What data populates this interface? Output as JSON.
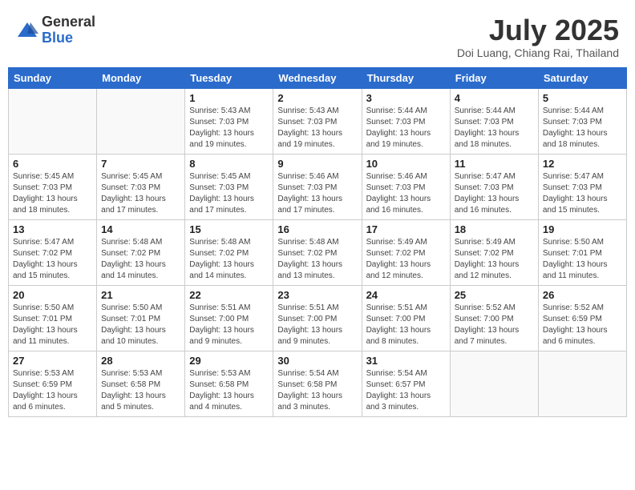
{
  "logo": {
    "general": "General",
    "blue": "Blue"
  },
  "header": {
    "month": "July 2025",
    "location": "Doi Luang, Chiang Rai, Thailand"
  },
  "weekdays": [
    "Sunday",
    "Monday",
    "Tuesday",
    "Wednesday",
    "Thursday",
    "Friday",
    "Saturday"
  ],
  "weeks": [
    [
      {
        "day": null,
        "detail": null
      },
      {
        "day": null,
        "detail": null
      },
      {
        "day": "1",
        "detail": "Sunrise: 5:43 AM\nSunset: 7:03 PM\nDaylight: 13 hours and 19 minutes."
      },
      {
        "day": "2",
        "detail": "Sunrise: 5:43 AM\nSunset: 7:03 PM\nDaylight: 13 hours and 19 minutes."
      },
      {
        "day": "3",
        "detail": "Sunrise: 5:44 AM\nSunset: 7:03 PM\nDaylight: 13 hours and 19 minutes."
      },
      {
        "day": "4",
        "detail": "Sunrise: 5:44 AM\nSunset: 7:03 PM\nDaylight: 13 hours and 18 minutes."
      },
      {
        "day": "5",
        "detail": "Sunrise: 5:44 AM\nSunset: 7:03 PM\nDaylight: 13 hours and 18 minutes."
      }
    ],
    [
      {
        "day": "6",
        "detail": "Sunrise: 5:45 AM\nSunset: 7:03 PM\nDaylight: 13 hours and 18 minutes."
      },
      {
        "day": "7",
        "detail": "Sunrise: 5:45 AM\nSunset: 7:03 PM\nDaylight: 13 hours and 17 minutes."
      },
      {
        "day": "8",
        "detail": "Sunrise: 5:45 AM\nSunset: 7:03 PM\nDaylight: 13 hours and 17 minutes."
      },
      {
        "day": "9",
        "detail": "Sunrise: 5:46 AM\nSunset: 7:03 PM\nDaylight: 13 hours and 17 minutes."
      },
      {
        "day": "10",
        "detail": "Sunrise: 5:46 AM\nSunset: 7:03 PM\nDaylight: 13 hours and 16 minutes."
      },
      {
        "day": "11",
        "detail": "Sunrise: 5:47 AM\nSunset: 7:03 PM\nDaylight: 13 hours and 16 minutes."
      },
      {
        "day": "12",
        "detail": "Sunrise: 5:47 AM\nSunset: 7:03 PM\nDaylight: 13 hours and 15 minutes."
      }
    ],
    [
      {
        "day": "13",
        "detail": "Sunrise: 5:47 AM\nSunset: 7:02 PM\nDaylight: 13 hours and 15 minutes."
      },
      {
        "day": "14",
        "detail": "Sunrise: 5:48 AM\nSunset: 7:02 PM\nDaylight: 13 hours and 14 minutes."
      },
      {
        "day": "15",
        "detail": "Sunrise: 5:48 AM\nSunset: 7:02 PM\nDaylight: 13 hours and 14 minutes."
      },
      {
        "day": "16",
        "detail": "Sunrise: 5:48 AM\nSunset: 7:02 PM\nDaylight: 13 hours and 13 minutes."
      },
      {
        "day": "17",
        "detail": "Sunrise: 5:49 AM\nSunset: 7:02 PM\nDaylight: 13 hours and 12 minutes."
      },
      {
        "day": "18",
        "detail": "Sunrise: 5:49 AM\nSunset: 7:02 PM\nDaylight: 13 hours and 12 minutes."
      },
      {
        "day": "19",
        "detail": "Sunrise: 5:50 AM\nSunset: 7:01 PM\nDaylight: 13 hours and 11 minutes."
      }
    ],
    [
      {
        "day": "20",
        "detail": "Sunrise: 5:50 AM\nSunset: 7:01 PM\nDaylight: 13 hours and 11 minutes."
      },
      {
        "day": "21",
        "detail": "Sunrise: 5:50 AM\nSunset: 7:01 PM\nDaylight: 13 hours and 10 minutes."
      },
      {
        "day": "22",
        "detail": "Sunrise: 5:51 AM\nSunset: 7:00 PM\nDaylight: 13 hours and 9 minutes."
      },
      {
        "day": "23",
        "detail": "Sunrise: 5:51 AM\nSunset: 7:00 PM\nDaylight: 13 hours and 9 minutes."
      },
      {
        "day": "24",
        "detail": "Sunrise: 5:51 AM\nSunset: 7:00 PM\nDaylight: 13 hours and 8 minutes."
      },
      {
        "day": "25",
        "detail": "Sunrise: 5:52 AM\nSunset: 7:00 PM\nDaylight: 13 hours and 7 minutes."
      },
      {
        "day": "26",
        "detail": "Sunrise: 5:52 AM\nSunset: 6:59 PM\nDaylight: 13 hours and 6 minutes."
      }
    ],
    [
      {
        "day": "27",
        "detail": "Sunrise: 5:53 AM\nSunset: 6:59 PM\nDaylight: 13 hours and 6 minutes."
      },
      {
        "day": "28",
        "detail": "Sunrise: 5:53 AM\nSunset: 6:58 PM\nDaylight: 13 hours and 5 minutes."
      },
      {
        "day": "29",
        "detail": "Sunrise: 5:53 AM\nSunset: 6:58 PM\nDaylight: 13 hours and 4 minutes."
      },
      {
        "day": "30",
        "detail": "Sunrise: 5:54 AM\nSunset: 6:58 PM\nDaylight: 13 hours and 3 minutes."
      },
      {
        "day": "31",
        "detail": "Sunrise: 5:54 AM\nSunset: 6:57 PM\nDaylight: 13 hours and 3 minutes."
      },
      {
        "day": null,
        "detail": null
      },
      {
        "day": null,
        "detail": null
      }
    ]
  ]
}
